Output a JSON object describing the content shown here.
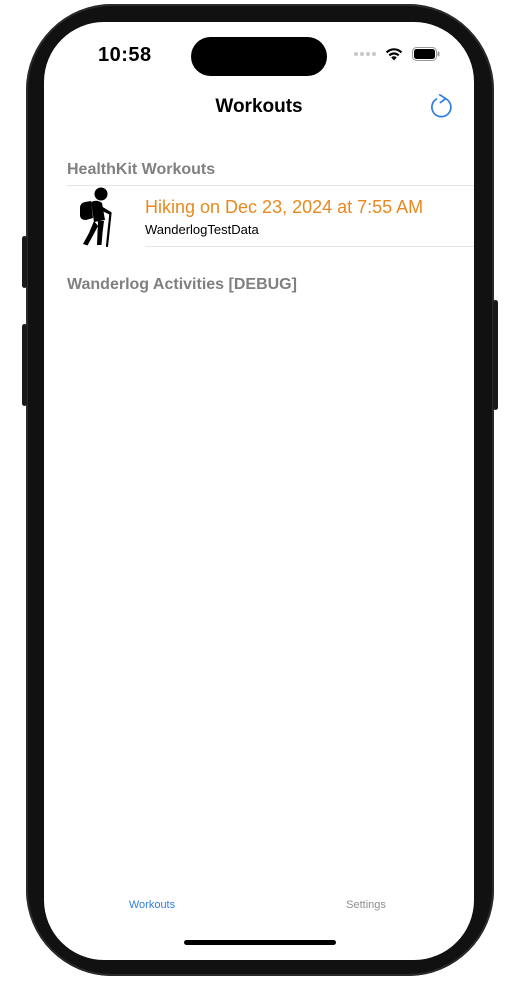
{
  "status_bar": {
    "time": "10:58",
    "icons": [
      "cellular-dots-icon",
      "wifi-icon",
      "battery-icon"
    ]
  },
  "nav": {
    "title": "Workouts",
    "refresh_icon": "arrow-clockwise-icon"
  },
  "sections": {
    "healthkit_header": "HealthKit Workouts",
    "wanderlog_header": "Wanderlog Activities [DEBUG]"
  },
  "workouts": [
    {
      "icon": "hiking-figure-icon",
      "title": "Hiking on Dec 23, 2024 at 7:55 AM",
      "subtitle": "WanderlogTestData"
    }
  ],
  "tabs": [
    {
      "label": "Workouts",
      "selected": true
    },
    {
      "label": "Settings",
      "selected": false
    }
  ],
  "colors": {
    "accent": "#2f7de0",
    "workout_title": "#e8891f",
    "section_header": "#808080",
    "tab_inactive": "#8e8e93"
  }
}
